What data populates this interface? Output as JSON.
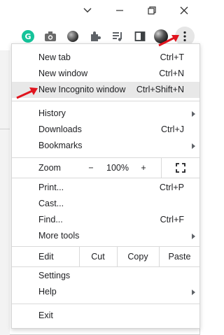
{
  "menu": {
    "new_tab": {
      "label": "New tab",
      "shortcut": "Ctrl+T"
    },
    "new_window": {
      "label": "New window",
      "shortcut": "Ctrl+N"
    },
    "new_incognito": {
      "label": "New Incognito window",
      "shortcut": "Ctrl+Shift+N"
    },
    "history": {
      "label": "History"
    },
    "downloads": {
      "label": "Downloads",
      "shortcut": "Ctrl+J"
    },
    "bookmarks": {
      "label": "Bookmarks"
    },
    "zoom": {
      "label": "Zoom",
      "minus": "−",
      "value": "100%",
      "plus": "+"
    },
    "print": {
      "label": "Print...",
      "shortcut": "Ctrl+P"
    },
    "cast": {
      "label": "Cast..."
    },
    "find": {
      "label": "Find...",
      "shortcut": "Ctrl+F"
    },
    "more_tools": {
      "label": "More tools"
    },
    "edit": {
      "label": "Edit",
      "cut": "Cut",
      "copy": "Copy",
      "paste": "Paste"
    },
    "settings": {
      "label": "Settings"
    },
    "help": {
      "label": "Help"
    },
    "exit": {
      "label": "Exit"
    }
  },
  "toolbar": {
    "icons": [
      "grammarly-icon",
      "camera-icon",
      "dark-circle-icon",
      "extensions-puzzle-icon",
      "media-controls-icon",
      "side-panel-icon",
      "profile-avatar",
      "more-menu-icon"
    ]
  },
  "colors": {
    "grammarly": "#15c39a",
    "highlight": "#e8e8e8",
    "annotation_arrow": "#e0141e"
  }
}
